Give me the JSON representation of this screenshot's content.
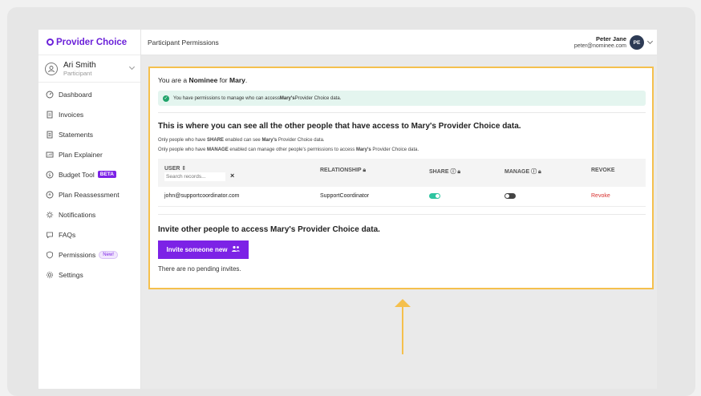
{
  "brand": {
    "name": "Provider Choice",
    "color": "#6b21d9"
  },
  "profile": {
    "name": "Ari Smith",
    "role": "Participant"
  },
  "sidebar": {
    "items": [
      {
        "label": "Dashboard",
        "icon": "dashboard-icon"
      },
      {
        "label": "Invoices",
        "icon": "invoice-icon"
      },
      {
        "label": "Statements",
        "icon": "statement-icon"
      },
      {
        "label": "Plan Explainer",
        "icon": "plan-icon"
      },
      {
        "label": "Budget Tool",
        "icon": "dollar-icon",
        "badge": "BETA"
      },
      {
        "label": "Plan Reassessment",
        "icon": "reassessment-icon"
      },
      {
        "label": "Notifications",
        "icon": "bell-icon"
      },
      {
        "label": "FAQs",
        "icon": "faq-icon"
      },
      {
        "label": "Permissions",
        "icon": "shield-icon",
        "badge": "New!"
      },
      {
        "label": "Settings",
        "icon": "gear-icon"
      }
    ]
  },
  "topbar": {
    "title": "Participant Permissions"
  },
  "user": {
    "name": "Peter Jane",
    "email": "peter@nominee.com",
    "initials": "PE"
  },
  "panel": {
    "nominee_prefix": "You are a ",
    "nominee_role": "Nominee",
    "nominee_mid": " for ",
    "nominee_name": "Mary",
    "nominee_end": ".",
    "alert_prefix": "You have permissions to manage who can access ",
    "alert_name": "Mary's",
    "alert_suffix": " Provider Choice data.",
    "heading": "This is where you can see all the other people that have access to Mary's Provider Choice data.",
    "note1_a": "Only people who have ",
    "note1_b": "SHARE",
    "note1_c": " enabled can see ",
    "note1_d": "Mary's",
    "note1_e": " Provider Choice data.",
    "note2_a": "Only people who have ",
    "note2_b": "MANAGE",
    "note2_c": " enabled can manage other people's permissions to access ",
    "note2_d": "Mary's",
    "note2_e": " Provider Choice data.",
    "invite_heading": "Invite other people to access Mary's Provider Choice data.",
    "invite_button": "Invite someone new",
    "pending": "There are no pending invites."
  },
  "table": {
    "headers": {
      "user": "USER",
      "relationship": "RELATIONSHIP",
      "share": "SHARE",
      "manage": "MANAGE",
      "revoke": "REVOKE"
    },
    "search_placeholder": "Search records...",
    "rows": [
      {
        "user": "john@supportcoordinator.com",
        "relationship": "SupportCoordinator",
        "share": true,
        "manage": false,
        "revoke": "Revoke"
      }
    ]
  },
  "colors": {
    "accent": "#7c22e6",
    "highlight": "#f5c04d",
    "toggle_on": "#2ec4a0",
    "toggle_off": "#444444",
    "revoke": "#d8312f"
  }
}
